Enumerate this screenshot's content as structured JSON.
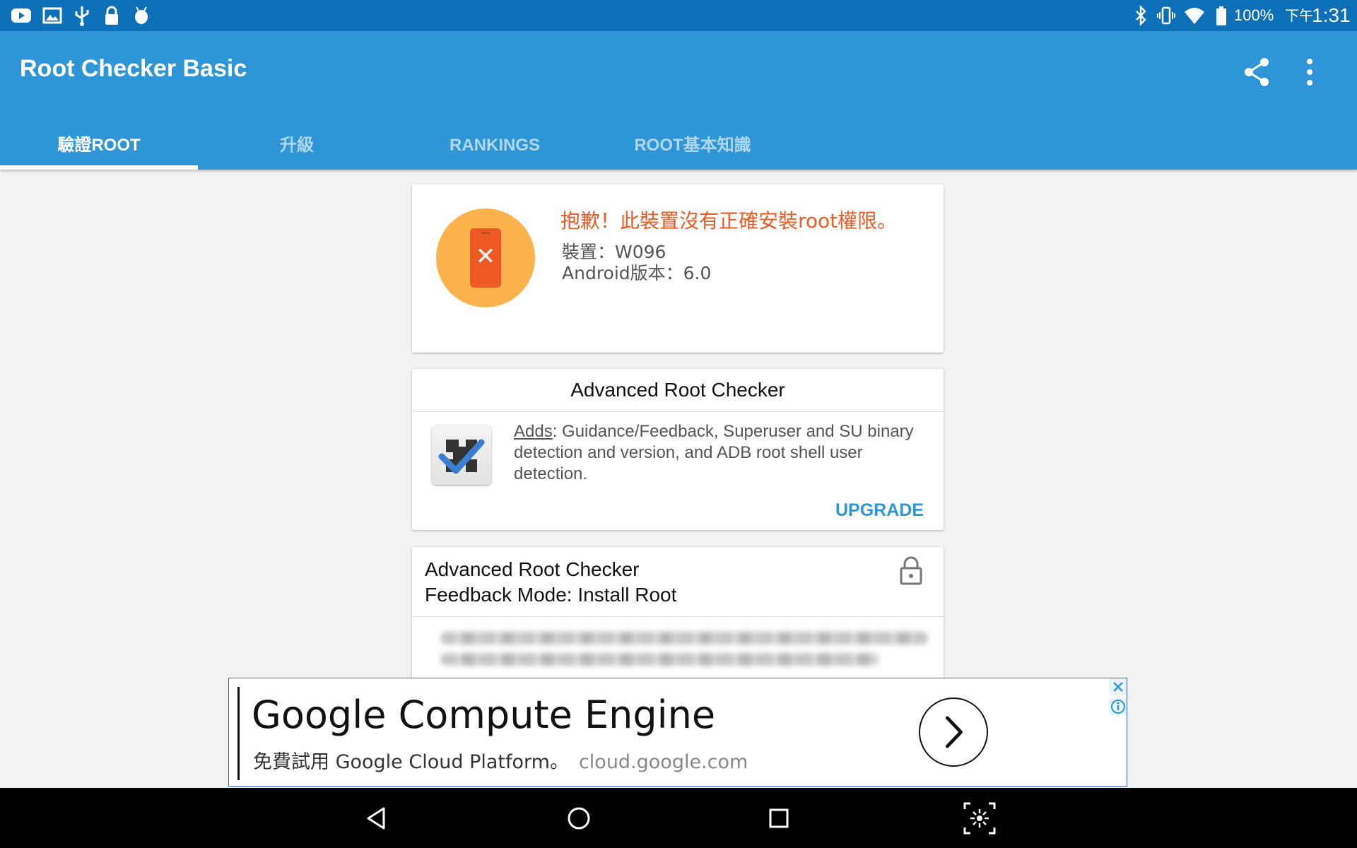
{
  "status_bar": {
    "left_icons": [
      "youtube-icon",
      "gallery-icon",
      "usb-icon",
      "lock-icon",
      "android-debug-icon"
    ],
    "right_icons": [
      "bluetooth-icon",
      "vibrate-icon",
      "wifi-icon",
      "battery-icon"
    ],
    "battery_text": "100%",
    "time_period": "下午",
    "time": "1:31"
  },
  "toolbar": {
    "title": "Root Checker Basic",
    "share_icon": "share-icon",
    "overflow_icon": "more-vert-icon"
  },
  "tabs": [
    {
      "label": "驗證ROOT",
      "active": true
    },
    {
      "label": "升級",
      "active": false
    },
    {
      "label": "RANKINGS",
      "active": false
    },
    {
      "label": "ROOT基本知識",
      "active": false
    }
  ],
  "result_card": {
    "icon": "phone-error-icon",
    "status_message": "抱歉！此裝置沒有正確安裝root權限。",
    "device_line": "裝置：W096",
    "android_version_line": "Android版本：6.0",
    "accent_color": "#ef5a24"
  },
  "upgrade_card": {
    "title": "Advanced Root Checker",
    "icon": "root-checker-app-icon",
    "adds_label": "Adds",
    "adds_text": ": Guidance/Feedback, Superuser and SU binary detection and version, and ADB root shell user detection.",
    "upgrade_label": "UPGRADE",
    "accent_color": "#2e96d6"
  },
  "feedback_card": {
    "title_line1": "Advanced Root Checker",
    "title_line2": "Feedback Mode: Install Root",
    "lock_icon": "lock-icon"
  },
  "ad_banner": {
    "title": "Google Compute Engine",
    "subtitle": "免費試用 Google Cloud Platform。",
    "url": "cloud.google.com",
    "arrow_icon": "chevron-right-icon",
    "close_icon": "close-icon",
    "info_icon": "info-icon"
  },
  "nav_bar": {
    "buttons": [
      "back-icon",
      "home-icon",
      "recents-icon",
      "screenshot-icon"
    ]
  }
}
